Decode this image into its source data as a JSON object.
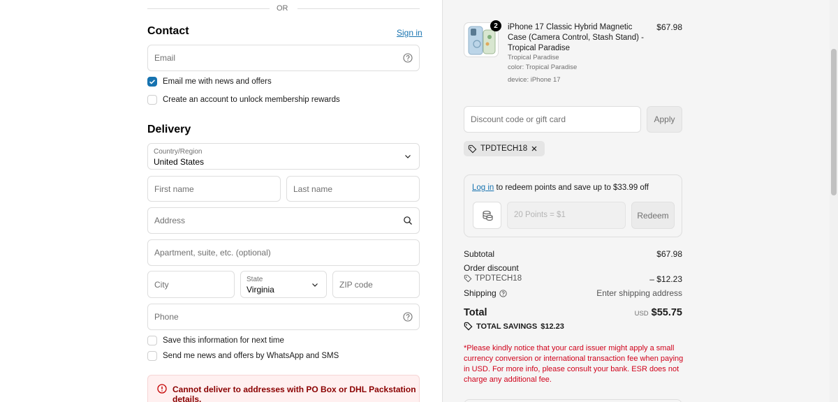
{
  "left": {
    "or_text": "OR",
    "contact": {
      "heading": "Contact",
      "sign_in": "Sign in",
      "email_placeholder": "Email",
      "news_label": "Email me with news and offers",
      "account_label": "Create an account to unlock membership rewards"
    },
    "delivery": {
      "heading": "Delivery",
      "country_label": "Country/Region",
      "country_value": "United States",
      "first_name": "First name",
      "last_name": "Last name",
      "address": "Address",
      "apartment": "Apartment, suite, etc. (optional)",
      "city": "City",
      "state_label": "State",
      "state_value": "Virginia",
      "zip": "ZIP code",
      "phone": "Phone",
      "save_label": "Save this information for next time",
      "whatsapp_label": "Send me news and offers by WhatsApp and SMS",
      "error": "Cannot deliver to addresses with PO Box or DHL Packstation details."
    }
  },
  "right": {
    "product": {
      "qty_badge": "2",
      "title": "iPhone 17 Classic Hybrid Magnetic Case (Camera Control, Stash Stand) - Tropical Paradise",
      "variant": "Tropical Paradise",
      "color": "color: Tropical Paradise",
      "device": "device: iPhone 17",
      "price": "$67.98"
    },
    "discount": {
      "placeholder": "Discount code or gift card",
      "apply": "Apply",
      "tag": "TPDTECH18"
    },
    "points": {
      "login_link": "Log in",
      "login_text": " to redeem points and save up to $33.99 off",
      "select_text": "20 Points = $1",
      "redeem": "Redeem"
    },
    "summary": {
      "subtotal_label": "Subtotal",
      "subtotal_value": "$67.98",
      "order_discount_label": "Order discount",
      "discount_code": "TPDTECH18",
      "discount_value": "– $12.23",
      "shipping_label": "Shipping",
      "shipping_value": "Enter shipping address",
      "total_label": "Total",
      "currency": "USD",
      "total_value": "$55.75",
      "savings_label": "TOTAL SAVINGS",
      "savings_value": "$12.23",
      "notice": "*Please kindly notice that your card issuer might apply a small currency conversion or international transaction fee when paying in USD. For more info, please consult your bank. ESR does not charge any additional fee."
    }
  },
  "colors": {
    "accent": "#1773b0",
    "error": "#c40000",
    "notice": "#d0021b"
  }
}
